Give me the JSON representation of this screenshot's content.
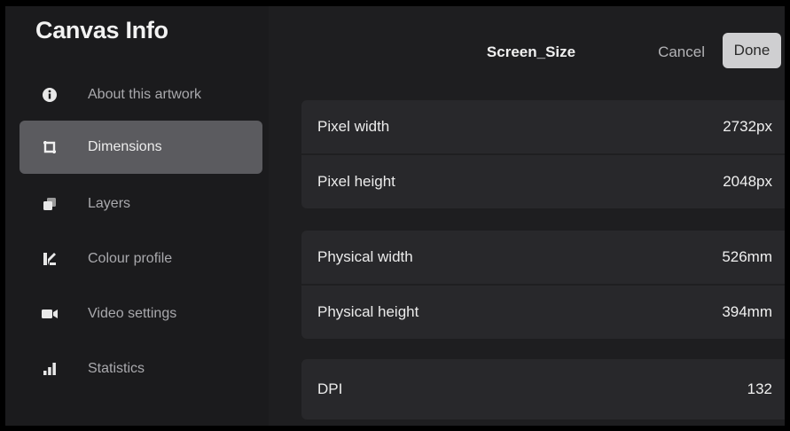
{
  "sidebar": {
    "title": "Canvas Info",
    "items": [
      {
        "label": "About this artwork",
        "icon": "info-icon"
      },
      {
        "label": "Dimensions",
        "icon": "dimensions-icon",
        "selected": true
      },
      {
        "label": "Layers",
        "icon": "layers-icon"
      },
      {
        "label": "Colour profile",
        "icon": "colour-profile-icon"
      },
      {
        "label": "Video settings",
        "icon": "video-camera-icon"
      },
      {
        "label": "Statistics",
        "icon": "bar-chart-icon"
      }
    ]
  },
  "header": {
    "title": "Screen_Size",
    "cancel_label": "Cancel",
    "done_label": "Done"
  },
  "dimensions": {
    "pixel": [
      {
        "label": "Pixel width",
        "value": "2732px"
      },
      {
        "label": "Pixel height",
        "value": "2048px"
      }
    ],
    "physical": [
      {
        "label": "Physical width",
        "value": "526mm"
      },
      {
        "label": "Physical height",
        "value": "394mm"
      }
    ],
    "dpi": {
      "label": "DPI",
      "value": "132"
    }
  },
  "colors": {
    "selected_item_bg": "#5b5b5f",
    "done_button_bg": "#cfcfd1"
  }
}
